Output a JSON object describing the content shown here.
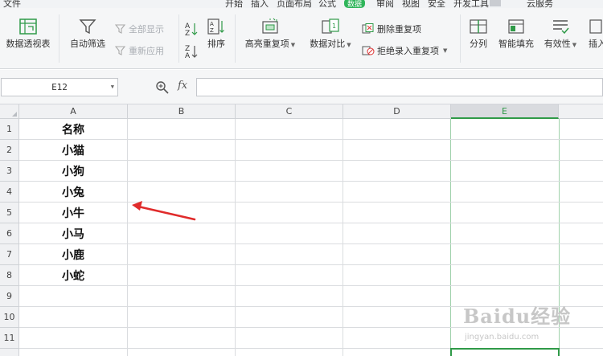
{
  "menu": {
    "items": [
      "文件",
      "开始",
      "插入",
      "页面布局",
      "公式",
      "数据",
      "审阅",
      "视图",
      "安全",
      "开发工具",
      "云服务"
    ]
  },
  "ribbon": {
    "pivot_label": "数据透视表",
    "autofilter_label": "自动筛选",
    "show_all_label": "全部显示",
    "reapply_label": "重新应用",
    "sort_label": "排序",
    "highlight_dup_label": "高亮重复项",
    "data_compare_label": "数据对比",
    "remove_dup_label": "删除重复项",
    "reject_dup_label": "拒绝录入重复项",
    "split_label": "分列",
    "smart_fill_label": "智能填充",
    "validity_label": "有效性",
    "insert_label": "插入"
  },
  "formula_bar": {
    "cell_ref": "E12",
    "fx": "fx",
    "formula": ""
  },
  "sheet": {
    "columns": [
      "A",
      "B",
      "C",
      "D",
      "E"
    ],
    "selected_column": "E",
    "rows": [
      "1",
      "2",
      "3",
      "4",
      "5",
      "6",
      "7",
      "8",
      "9",
      "10",
      "11"
    ],
    "column_a_values": [
      "名称",
      "小猫",
      "小狗",
      "小兔",
      "小牛",
      "小马",
      "小鹿",
      "小蛇"
    ]
  },
  "watermark": {
    "text": "Baidu经验",
    "sub": "jingyan.baidu.com"
  },
  "colors": {
    "accent": "#2f9a48",
    "arrow": "#e02b2b",
    "watermark": "#c7c7c7"
  }
}
